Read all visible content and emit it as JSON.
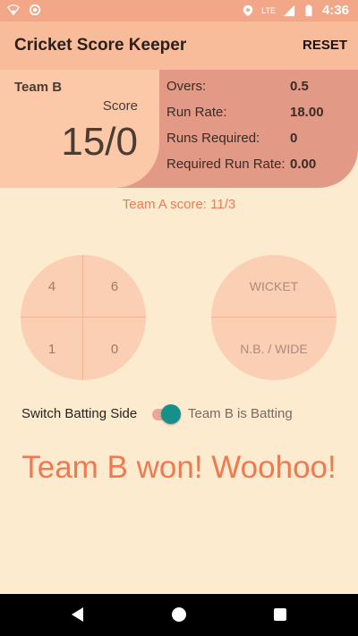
{
  "status_bar": {
    "time": "4:36",
    "network_label": "LTE",
    "icons": [
      "wifi-off-icon",
      "sync-icon",
      "location-icon",
      "signal-icon",
      "battery-icon"
    ]
  },
  "app_bar": {
    "title": "Cricket Score Keeper",
    "reset_label": "RESET"
  },
  "score_card": {
    "team_name": "Team B",
    "score_label": "Score",
    "score_value": "15/0",
    "stats": [
      {
        "label": "Overs:",
        "value": "0.5"
      },
      {
        "label": "Run Rate:",
        "value": "18.00"
      },
      {
        "label": "Runs Required:",
        "value": "0"
      },
      {
        "label": "Required Run Rate:",
        "value": "0.00"
      }
    ]
  },
  "team_a_score": "Team A score:  11/3",
  "runs_pad": {
    "top_left": "4",
    "top_right": "6",
    "bottom_left": "1",
    "bottom_right": "0"
  },
  "extras_pad": {
    "top": "WICKET",
    "bottom": "N.B. / WIDE"
  },
  "switch": {
    "label": "Switch Batting Side",
    "state_text": "Team B is Batting",
    "on": true
  },
  "result_text": "Team B won! Woohoo!",
  "colors": {
    "background": "#fcebcf",
    "app_bar": "#f9bc9b",
    "accent": "#ef7a52",
    "switch_on": "#178f8a"
  }
}
